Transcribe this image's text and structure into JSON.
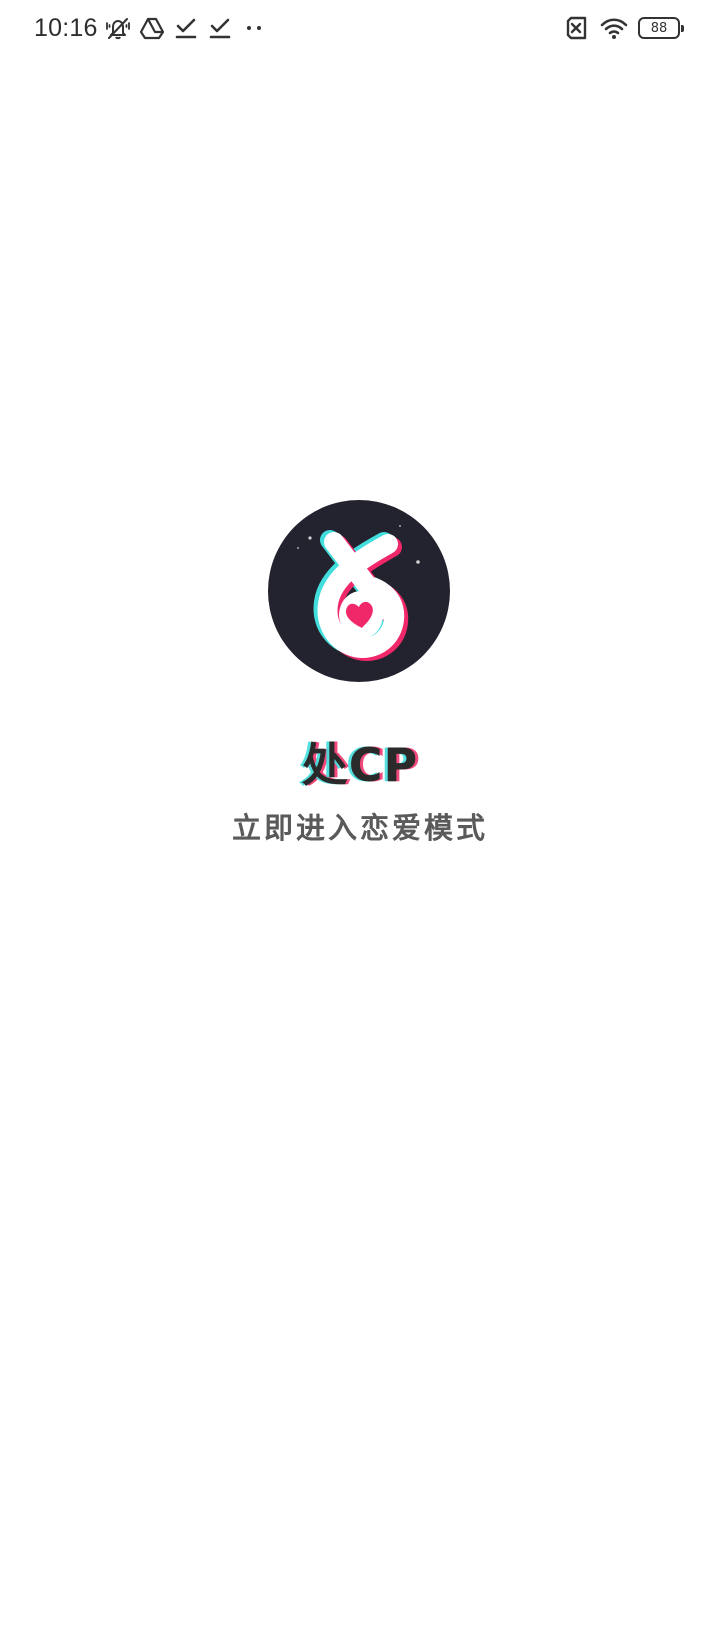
{
  "status_bar": {
    "time": "10:16",
    "battery_level": "88",
    "icons_left": [
      "vibrate-icon",
      "drive-icon",
      "download-done-icon",
      "download-done-icon",
      "more-dots-icon"
    ],
    "icons_right": [
      "no-sim-icon",
      "wifi-icon",
      "battery-icon"
    ]
  },
  "splash": {
    "app_name": "处CP",
    "tagline": "立即进入恋爱模式"
  },
  "colors": {
    "logo_background": "#22232f",
    "accent_pink": "#f0286a",
    "accent_cyan": "#42dddd",
    "text_dark": "#2a2a2a",
    "text_gray": "#5a5a5a"
  }
}
